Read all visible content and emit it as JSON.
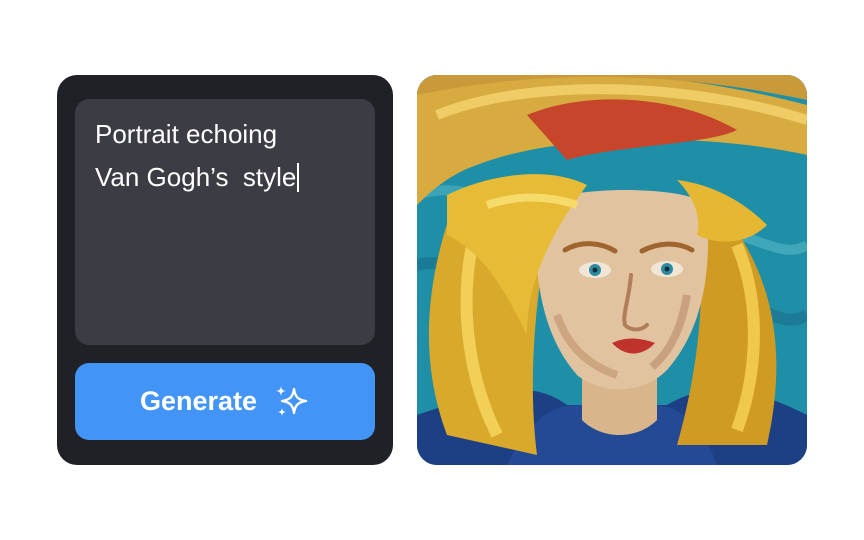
{
  "prompt": {
    "lines": [
      "Portrait echoing",
      "Van Gogh’s  style"
    ]
  },
  "generate_button": {
    "label": "Generate",
    "icon": "sparkles-icon",
    "color": "#4294f7"
  },
  "panel": {
    "background": "#202127",
    "input_background": "#3b3c44"
  },
  "image": {
    "subject": "painted-portrait-woman-straw-hat"
  }
}
